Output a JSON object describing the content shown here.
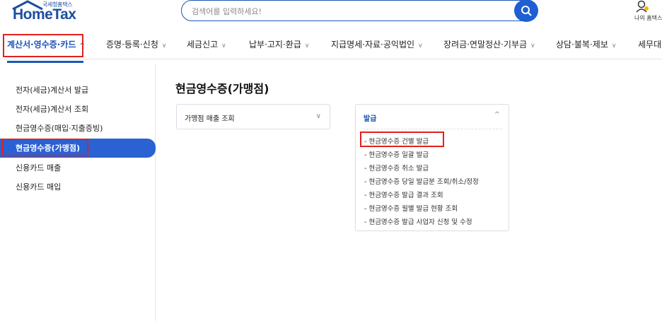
{
  "header": {
    "logo_small": "국세청홈택스",
    "logo_main": "HomeTax",
    "search_placeholder": "검색어를 입력하세요!",
    "my_home_label": "나의 홈택스"
  },
  "nav": {
    "items": [
      {
        "label": "계산서·영수증·카드",
        "chevron": "^"
      },
      {
        "label": "증명·등록·신청",
        "chevron": "∨"
      },
      {
        "label": "세금신고",
        "chevron": "∨"
      },
      {
        "label": "납부·고지·환급",
        "chevron": "∨"
      },
      {
        "label": "지급명세·자료·공익법인",
        "chevron": "∨"
      },
      {
        "label": "장려금·연말정산·기부금",
        "chevron": "∨"
      },
      {
        "label": "상담·불복·제보",
        "chevron": "∨"
      },
      {
        "label": "세무대리",
        "chevron": ""
      }
    ]
  },
  "sidebar": {
    "items": [
      {
        "label": "전자(세금)계산서 발급"
      },
      {
        "label": "전자(세금)계산서 조회"
      },
      {
        "label": "현금영수증(매입·지출증빙)"
      },
      {
        "label": "현금영수증(가맹점)"
      },
      {
        "label": "신용카드 매출"
      },
      {
        "label": "신용카드 매입"
      }
    ]
  },
  "main": {
    "title": "현금영수증(가맹점)",
    "left_card": {
      "label": "가맹점 매출 조회",
      "chevron": "∨"
    },
    "right_card": {
      "label": "발급",
      "chevron": "^",
      "items": [
        {
          "label": "- 현금영수증 건별 발급"
        },
        {
          "label": "- 현금영수증 일괄 발급"
        },
        {
          "label": "- 현금영수증 취소 발급"
        },
        {
          "label": "- 현금영수증 당일 발급분 조회/취소/정정"
        },
        {
          "label": "- 현금영수증 발급 결과 조회"
        },
        {
          "label": "- 현금영수증 월별 발급 현황 조회"
        },
        {
          "label": "- 현금영수증 발급 사업자 신청 및 수정"
        }
      ]
    }
  },
  "colors": {
    "brand": "#1c57b8",
    "active_bg": "#2a62d4",
    "highlight": "#e2211c"
  }
}
